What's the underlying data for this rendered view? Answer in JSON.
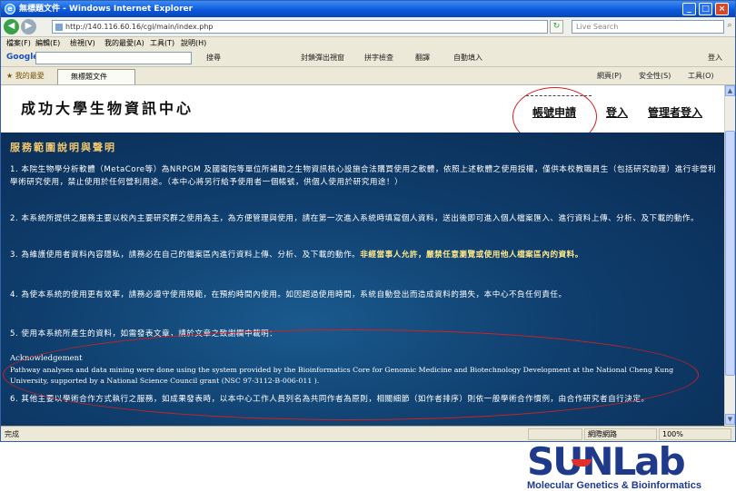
{
  "window": {
    "title": "無標題文件 - Windows Internet Explorer",
    "min_icon": "minimize-icon",
    "max_icon": "maximize-icon",
    "close_icon": "close-icon"
  },
  "address": {
    "url": "http://140.116.60.16/cgi/main/index.php",
    "search_placeholder": "Live Search"
  },
  "menu": [
    "檔案(F)",
    "編輯(E)",
    "檢視(V)",
    "我的最愛(A)",
    "工具(T)",
    "說明(H)"
  ],
  "google_toolbar": {
    "logo": "Google",
    "items": [
      "搜尋",
      "封鎖彈出視窗",
      "拼字檢查",
      "翻譯",
      "自動填入",
      "登入"
    ]
  },
  "favorites": {
    "label": "我的最愛",
    "tab_title": "無標題文件",
    "tools": [
      "網頁(P)",
      "安全性(S)",
      "工具(O)"
    ]
  },
  "page": {
    "site_title": "成功大學生物資訊中心",
    "nav": [
      "帳號申請",
      "登入",
      "管理者登入"
    ],
    "section_title": "服務範圍說明與聲明",
    "paragraphs": [
      "1. 本院生物學分析軟體（MetaCore等）為NRPGM 及國衛院等單位所補助之生物資訊核心設施合法購買使用之軟體，依照上述軟體之使用授權，僅供本校教職員生（包括研究助理）進行非營利學術研究使用，禁止使用於任何營利用途。（本中心將另行給予使用者一個帳號，供個人使用於研究用途！）",
      "2. 本系統所提供之服務主要以校內主要研究群之使用為主，為方便管理與使用，請在第一次進入系統時填寫個人資料，送出後即可進入個人檔案匯入、進行資料上傳、分析、及下載的動作。",
      "3. 為維護使用者資料內容隱私，請務必在自己的檔案區內進行資料上傳、分析、及下載的動作。",
      "4. 為使本系統的使用更有效率，請務必遵守使用規範，在預約時間內使用。如因超過使用時間，系統自動登出而造成資料的損失，本中心不負任何責任。",
      "5. 使用本系統所產生的資料，如需發表文章，請於文章之致謝欄中載明："
    ],
    "bold_spans": [
      "非經當事人允許，嚴禁任意瀏覽或使用他人檔案區內的資料。",
      "請務必遵守使用規範，在預約時間內使用"
    ],
    "ack_heading": "Acknowledgement",
    "ack_text": "Pathway analyses and data mining were done using the system provided by the Bioinformatics Core for Genomic Medicine and Biotechnology Development at the National Cheng Kung University, supported by a National Science Council grant (NSC 97-3112-B-006-011 ).",
    "paragraph6": "6. 其他主要以學術合作方式執行之服務，如成果發表時，以本中心工作人員列名為共同作者為原則，相關細節（如作者排序）則依一般學術合作慣例，由合作研究者自行決定。"
  },
  "status": {
    "done": "完成",
    "zone": "網際網路",
    "zoom": "100%"
  },
  "logo": {
    "text": "SUNLab",
    "subtitle": "Molecular Genetics & Bioinformatics"
  }
}
